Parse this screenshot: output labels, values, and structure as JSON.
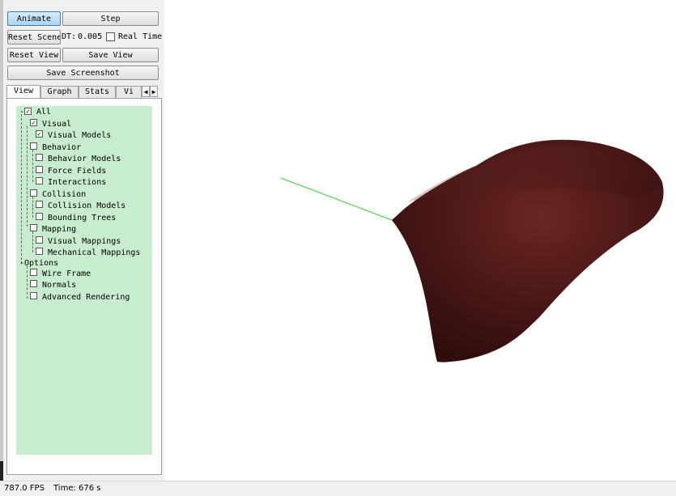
{
  "toolbar": {
    "animate_label": "Animate",
    "step_label": "Step",
    "reset_scene_label": "Reset Scene",
    "dt_label": "DT:",
    "dt_value": "0.005",
    "real_time_label": "Real Time",
    "reset_view_label": "Reset View",
    "save_view_label": "Save View",
    "save_screenshot_label": "Save Screenshot"
  },
  "tabs": [
    {
      "label": "View",
      "active": true
    },
    {
      "label": "Graph"
    },
    {
      "label": "Stats"
    },
    {
      "label": "Vi"
    }
  ],
  "tree": {
    "all": "All",
    "visual": "Visual",
    "visual_models": "Visual Models",
    "behavior": "Behavior",
    "behavior_models": "Behavior Models",
    "force_fields": "Force Fields",
    "interactions": "Interactions",
    "collision": "Collision",
    "collision_models": "Collision Models",
    "bounding_trees": "Bounding Trees",
    "mapping": "Mapping",
    "visual_mappings": "Visual Mappings",
    "mechanical_mappings": "Mechanical Mappings",
    "options": "Options",
    "wire_frame": "Wire Frame",
    "normals": "Normals",
    "advanced_rendering": "Advanced Rendering"
  },
  "status": {
    "fps": "787.0 FPS",
    "time": "Time: 676 s"
  },
  "colors": {
    "tree_bg": "#c8ecce",
    "animate_active": "#a9d4f5",
    "organ": "#4a1716",
    "axis_line": "#33cc33"
  }
}
